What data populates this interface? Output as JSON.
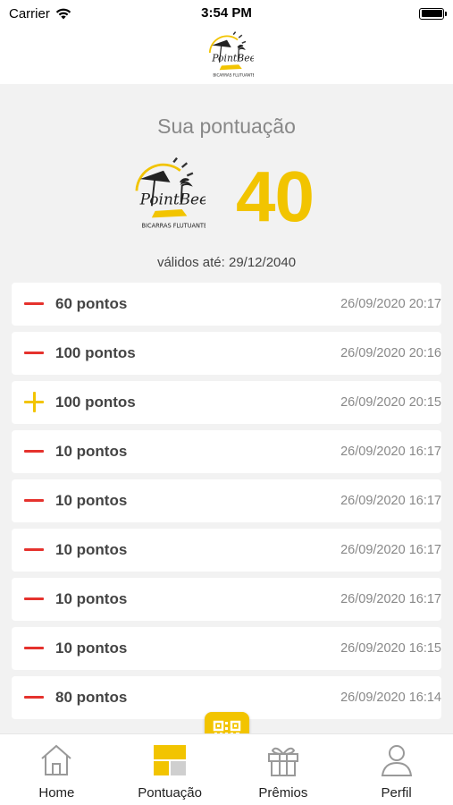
{
  "status_bar": {
    "carrier": "Carrier",
    "time": "3:54 PM"
  },
  "brand": {
    "logo_icon": "pointbeer-logo",
    "accent_color": "#f2c400"
  },
  "score": {
    "title": "Sua pontuação",
    "value": "40",
    "valid_until": "válidos até: 29/12/2040"
  },
  "history": [
    {
      "type": "minus",
      "points": "60 pontos",
      "date": "26/09/2020 20:17"
    },
    {
      "type": "minus",
      "points": "100 pontos",
      "date": "26/09/2020 20:16"
    },
    {
      "type": "plus",
      "points": "100 pontos",
      "date": "26/09/2020 20:15"
    },
    {
      "type": "minus",
      "points": "10 pontos",
      "date": "26/09/2020 16:17"
    },
    {
      "type": "minus",
      "points": "10 pontos",
      "date": "26/09/2020 16:17"
    },
    {
      "type": "minus",
      "points": "10 pontos",
      "date": "26/09/2020 16:17"
    },
    {
      "type": "minus",
      "points": "10 pontos",
      "date": "26/09/2020 16:17"
    },
    {
      "type": "minus",
      "points": "10 pontos",
      "date": "26/09/2020 16:15"
    },
    {
      "type": "minus",
      "points": "80 pontos",
      "date": "26/09/2020 16:14"
    }
  ],
  "tabs": [
    {
      "label": "Home",
      "icon": "home-icon"
    },
    {
      "label": "Pontuação",
      "icon": "score-icon"
    },
    {
      "label": "Prêmios",
      "icon": "gift-icon"
    },
    {
      "label": "Perfil",
      "icon": "profile-icon"
    }
  ],
  "qr": {
    "icon": "qr-code-icon"
  }
}
